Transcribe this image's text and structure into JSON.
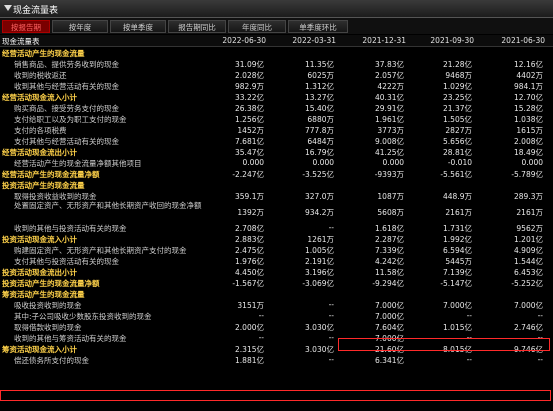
{
  "window": {
    "title": "现金流量表"
  },
  "tabs": [
    "按报告期",
    "按年度",
    "按单季度",
    "报告期同比",
    "年度同比",
    "单季度环比"
  ],
  "header": {
    "first": "现金流量表",
    "periods": [
      "2022-06-30",
      "2022-03-31",
      "2021-12-31",
      "2021-09-30",
      "2021-06-30"
    ]
  },
  "rows": [
    {
      "type": "sec",
      "label": "经营活动产生的现金流量",
      "values": [
        "",
        "",
        "",
        "",
        ""
      ]
    },
    {
      "type": "item",
      "label": "销售商品、提供劳务收到的现金",
      "values": [
        "31.09亿",
        "11.35亿",
        "37.83亿",
        "21.28亿",
        "12.16亿"
      ]
    },
    {
      "type": "item",
      "label": "收到的税收返还",
      "values": [
        "2.028亿",
        "6025万",
        "2.057亿",
        "9468万",
        "4402万"
      ]
    },
    {
      "type": "item",
      "label": "收到其他与经营活动有关的现金",
      "values": [
        "982.9万",
        "1.312亿",
        "4222万",
        "1.029亿",
        "984.1万"
      ]
    },
    {
      "type": "sec",
      "label": "经营活动现金流入小计",
      "values": [
        "33.22亿",
        "13.27亿",
        "40.31亿",
        "23.25亿",
        "12.70亿"
      ]
    },
    {
      "type": "item",
      "label": "购买商品、接受劳务支付的现金",
      "values": [
        "26.38亿",
        "15.40亿",
        "29.91亿",
        "21.37亿",
        "15.28亿"
      ]
    },
    {
      "type": "item",
      "label": "支付给职工以及为职工支付的现金",
      "values": [
        "1.256亿",
        "6880万",
        "1.961亿",
        "1.505亿",
        "1.038亿"
      ]
    },
    {
      "type": "item",
      "label": "支付的各项税费",
      "values": [
        "1452万",
        "777.8万",
        "3773万",
        "2827万",
        "1615万"
      ]
    },
    {
      "type": "item",
      "label": "支付其他与经营活动有关的现金",
      "values": [
        "7.681亿",
        "6484万",
        "9.008亿",
        "5.656亿",
        "2.008亿"
      ]
    },
    {
      "type": "sec",
      "label": "经营活动现金流出小计",
      "values": [
        "35.47亿",
        "16.79亿",
        "41.25亿",
        "28.81亿",
        "18.49亿"
      ]
    },
    {
      "type": "item",
      "label": "经营活动产生的现金流量净额其他项目",
      "values": [
        "0.000",
        "0.000",
        "0.000",
        "-0.010",
        "0.000"
      ]
    },
    {
      "type": "sec",
      "label": "经营活动产生的现金流量净额",
      "values": [
        "-2.247亿",
        "-3.525亿",
        "-9393万",
        "-5.561亿",
        "-5.789亿"
      ]
    },
    {
      "type": "sec",
      "label": "投资活动产生的现金流量",
      "values": [
        "",
        "",
        "",
        "",
        ""
      ]
    },
    {
      "type": "item",
      "label": "取得投资收益收到的现金",
      "values": [
        "359.1万",
        "327.0万",
        "1087万",
        "448.9万",
        "289.3万"
      ]
    },
    {
      "type": "item",
      "tall": true,
      "label": "处置固定资产、无形资产和其他长期资产收回的现金净额",
      "values": [
        "1392万",
        "934.2万",
        "5608万",
        "2161万",
        "2161万"
      ]
    },
    {
      "type": "item",
      "label": "收到的其他与投资活动有关的现金",
      "values": [
        "2.708亿",
        "--",
        "1.618亿",
        "1.731亿",
        "9562万"
      ]
    },
    {
      "type": "sec",
      "label": "投资活动现金流入小计",
      "values": [
        "2.883亿",
        "1261万",
        "2.287亿",
        "1.992亿",
        "1.201亿"
      ]
    },
    {
      "type": "item",
      "label": "购建固定资产、无形资产和其他长期资产支付的现金",
      "values": [
        "2.475亿",
        "1.005亿",
        "7.339亿",
        "6.594亿",
        "4.909亿"
      ]
    },
    {
      "type": "item",
      "label": "支付其他与投资活动有关的现金",
      "values": [
        "1.976亿",
        "2.191亿",
        "4.242亿",
        "5445万",
        "1.544亿"
      ]
    },
    {
      "type": "sec",
      "label": "投资活动现金流出小计",
      "values": [
        "4.450亿",
        "3.196亿",
        "11.58亿",
        "7.139亿",
        "6.453亿"
      ]
    },
    {
      "type": "sec",
      "label": "投资活动产生的现金流量净额",
      "values": [
        "-1.567亿",
        "-3.069亿",
        "-9.294亿",
        "-5.147亿",
        "-5.252亿"
      ]
    },
    {
      "type": "sec",
      "label": "筹资活动产生的现金流量",
      "values": [
        "",
        "",
        "",
        "",
        ""
      ]
    },
    {
      "type": "item",
      "label": "吸收投资收到的现金",
      "values": [
        "3151万",
        "--",
        "7.000亿",
        "7.000亿",
        "7.000亿"
      ]
    },
    {
      "type": "item",
      "label": "其中:子公司吸收少数股东投资收到的现金",
      "values": [
        "--",
        "--",
        "7.000亿",
        "--",
        "--"
      ]
    },
    {
      "type": "item",
      "label": "取得借款收到的现金",
      "values": [
        "2.000亿",
        "3.030亿",
        "7.604亿",
        "1.015亿",
        "2.746亿"
      ]
    },
    {
      "type": "item",
      "label": "收到的其他与筹资活动有关的现金",
      "values": [
        "--",
        "--",
        "7.000亿",
        "--",
        "--"
      ]
    },
    {
      "type": "sec",
      "label": "筹资活动现金流入小计",
      "values": [
        "2.315亿",
        "3.030亿",
        "21.60亿",
        "8.015亿",
        "9.746亿"
      ]
    },
    {
      "type": "item",
      "label": "偿还债务所支付的现金",
      "values": [
        "1.881亿",
        "--",
        "6.341亿",
        "--",
        "--"
      ]
    }
  ],
  "colors": {
    "highlight": "#ff2a2a",
    "section_text": "#ffd24a",
    "active_tab": "#7a0000"
  }
}
